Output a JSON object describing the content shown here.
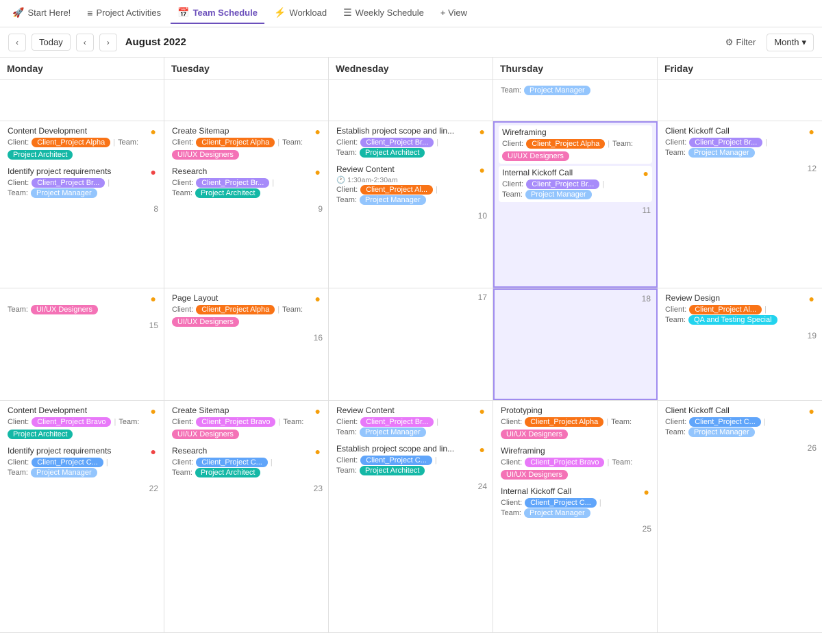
{
  "nav": {
    "tabs": [
      {
        "id": "start",
        "label": "Start Here!",
        "icon": "🚀",
        "active": false
      },
      {
        "id": "activities",
        "label": "Project Activities",
        "icon": "≡",
        "active": false
      },
      {
        "id": "team",
        "label": "Team Schedule",
        "icon": "📅",
        "active": true
      },
      {
        "id": "workload",
        "label": "Workload",
        "icon": "⚡",
        "active": false
      },
      {
        "id": "weekly",
        "label": "Weekly Schedule",
        "icon": "☰",
        "active": false
      },
      {
        "id": "view",
        "label": "+ View",
        "icon": "",
        "active": false
      }
    ]
  },
  "toolbar": {
    "today": "Today",
    "date": "August 2022",
    "filter": "Filter",
    "view": "Month"
  },
  "days": [
    "Monday",
    "Tuesday",
    "Wednesday",
    "Thursday",
    "Friday"
  ],
  "weeks": [
    {
      "cells": [
        {
          "dayNum": "",
          "tasks": []
        },
        {
          "dayNum": "",
          "tasks": []
        },
        {
          "dayNum": "",
          "tasks": []
        },
        {
          "dayNum": "",
          "tasks": [
            {
              "title": "",
              "client": null,
              "clientBadge": null,
              "team": "Project Manager",
              "teamBadge": "badge-lightblue",
              "dot": null,
              "time": null
            }
          ]
        },
        {
          "dayNum": ""
        }
      ]
    },
    {
      "cells": [
        {
          "dayNum": "8",
          "tasks": [
            {
              "title": "Content Development",
              "client": "Client_Project Alpha",
              "clientBadge": "badge-orange",
              "team": "Project Architect",
              "teamBadge": "badge-teal",
              "dot": "yellow"
            },
            {
              "title": "Identify project requirements",
              "client": "Client_Project Br...",
              "clientBadge": "badge-purple",
              "team": "Project Manager",
              "teamBadge": "badge-lightblue",
              "dot": "red"
            }
          ]
        },
        {
          "dayNum": "9",
          "tasks": [
            {
              "title": "Create Sitemap",
              "client": "Client_Project Alpha",
              "clientBadge": "badge-orange",
              "team": "UI/UX Designers",
              "teamBadge": "badge-pink",
              "dot": "yellow"
            },
            {
              "title": "Research",
              "client": "Client_Project Br...",
              "clientBadge": "badge-purple",
              "team": "Project Architect",
              "teamBadge": "badge-teal",
              "dot": "yellow"
            }
          ]
        },
        {
          "dayNum": "10",
          "tasks": [
            {
              "title": "Establish project scope and lin...",
              "client": "Client_Project Br...",
              "clientBadge": "badge-purple",
              "team": "Project Architect",
              "teamBadge": "badge-teal",
              "dot": "yellow"
            },
            {
              "title": "Review Content",
              "time": "1:30am-2:30am",
              "client": "Client_Project Al...",
              "clientBadge": "badge-orange",
              "team": "Project Manager",
              "teamBadge": "badge-lightblue",
              "dot": "yellow"
            }
          ]
        },
        {
          "dayNum": "11",
          "highlight": true,
          "tasks": [
            {
              "title": "Wireframing",
              "client": "Client_Project Alpha",
              "clientBadge": "badge-orange",
              "team": "UI/UX Designers",
              "teamBadge": "badge-pink",
              "dot": null
            },
            {
              "title": "Internal Kickoff Call",
              "client": "Client_Project Br...",
              "clientBadge": "badge-purple",
              "team": "Project Manager",
              "teamBadge": "badge-lightblue",
              "dot": "yellow"
            }
          ]
        },
        {
          "dayNum": "12",
          "tasks": [
            {
              "title": "Client Kickoff Call",
              "client": "Client_Project Br...",
              "clientBadge": "badge-purple",
              "team": "Project Manager",
              "teamBadge": "badge-lightblue",
              "dot": "yellow"
            }
          ]
        }
      ]
    },
    {
      "cells": [
        {
          "dayNum": "15",
          "tasks": [
            {
              "title": "",
              "client": null,
              "clientBadge": null,
              "team": "UI/UX Designers",
              "teamBadge": "badge-pink",
              "dot": "yellow",
              "teamOnly": true
            }
          ]
        },
        {
          "dayNum": "16",
          "tasks": [
            {
              "title": "Page Layout",
              "client": "Client_Project Alpha",
              "clientBadge": "badge-orange",
              "team": "UI/UX Designers",
              "teamBadge": "badge-pink",
              "dot": "yellow"
            }
          ]
        },
        {
          "dayNum": "17",
          "tasks": []
        },
        {
          "dayNum": "18",
          "highlight": true,
          "tasks": []
        },
        {
          "dayNum": "19",
          "tasks": [
            {
              "title": "Review Design",
              "client": "Client_Project Al...",
              "clientBadge": "badge-orange",
              "team": "QA and Testing Special",
              "teamBadge": "badge-cyan",
              "dot": "yellow"
            }
          ]
        }
      ]
    },
    {
      "cells": [
        {
          "dayNum": "22",
          "tasks": [
            {
              "title": "Content Development",
              "client": "Client_Project Bravo",
              "clientBadge": "badge-magenta",
              "team": "Project Architect",
              "teamBadge": "badge-teal",
              "dot": "yellow"
            },
            {
              "title": "Identify project requirements",
              "client": "Client_Project C...",
              "clientBadge": "badge-blue",
              "team": "Project Manager",
              "teamBadge": "badge-lightblue",
              "dot": "red"
            }
          ]
        },
        {
          "dayNum": "23",
          "tasks": [
            {
              "title": "Create Sitemap",
              "client": "Client_Project Bravo",
              "clientBadge": "badge-magenta",
              "team": "UI/UX Designers",
              "teamBadge": "badge-pink",
              "dot": "yellow"
            },
            {
              "title": "Research",
              "client": "Client_Project C...",
              "clientBadge": "badge-blue",
              "team": "Project Architect",
              "teamBadge": "badge-teal",
              "dot": "yellow"
            }
          ]
        },
        {
          "dayNum": "24",
          "tasks": [
            {
              "title": "Review Content",
              "client": "Client_Project Br...",
              "clientBadge": "badge-magenta",
              "team": "Project Manager",
              "teamBadge": "badge-lightblue",
              "dot": "yellow"
            },
            {
              "title": "Establish project scope and lin...",
              "client": "Client_Project C...",
              "clientBadge": "badge-blue",
              "team": "Project Architect",
              "teamBadge": "badge-teal",
              "dot": "yellow"
            }
          ]
        },
        {
          "dayNum": "25",
          "tasks": [
            {
              "title": "Prototyping",
              "client": "Client_Project Alpha",
              "clientBadge": "badge-orange",
              "team": "UI/UX Designers",
              "teamBadge": "badge-pink",
              "dot": null
            },
            {
              "title": "Wireframing",
              "client": "Client_Project Bravo",
              "clientBadge": "badge-magenta",
              "team": "UI/UX Designers",
              "teamBadge": "badge-pink",
              "dot": null
            },
            {
              "title": "Internal Kickoff Call",
              "client": "Client_Project C...",
              "clientBadge": "badge-blue",
              "team": "Project Manager",
              "teamBadge": "badge-lightblue",
              "dot": "yellow"
            }
          ]
        },
        {
          "dayNum": "26",
          "tasks": [
            {
              "title": "Client Kickoff Call",
              "client": "Client_Project C...",
              "clientBadge": "badge-blue",
              "team": "Project Manager",
              "teamBadge": "badge-lightblue",
              "dot": "yellow"
            }
          ]
        }
      ]
    }
  ]
}
